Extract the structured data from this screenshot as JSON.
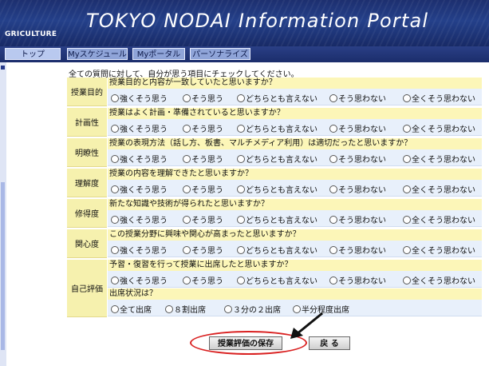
{
  "banner": {
    "left_text": "GRICULTURE",
    "title": "TOKYO NODAI Information Portal"
  },
  "nav": {
    "tabs": [
      "トップ",
      "Myスケジュール",
      "Myポータル",
      "パーソナライズ"
    ]
  },
  "form": {
    "intro": "全ての質問に対して、自分が思う項目にチェックしてください。",
    "scale_options": [
      "強くそう思う",
      "そう思う",
      "どちらとも言えない",
      "そう思わない",
      "全くそう思わない"
    ],
    "questions": [
      {
        "label": "授業目的",
        "text": "授業目的と内容が一致していたと思いますか？"
      },
      {
        "label": "計画性",
        "text": "授業はよく計画・準備されていると思いますか？"
      },
      {
        "label": "明瞭性",
        "text": "授業の表現方法（話し方、板書、マルチメディア利用）は適切だったと思いますか？"
      },
      {
        "label": "理解度",
        "text": "授業の内容を理解できたと思いますか？"
      },
      {
        "label": "修得度",
        "text": "新たな知識や技術が得られたと思いますか？"
      },
      {
        "label": "関心度",
        "text": "この授業分野に興味や関心が高まったと思いますか？"
      },
      {
        "label": "自己評価",
        "text": "予習・復習を行って授業に出席したと思いますか？"
      }
    ],
    "attendance": {
      "text": "出席状況は？",
      "options": [
        "全て出席",
        "８割出席",
        "３分の２出席",
        "半分程度出席"
      ]
    }
  },
  "buttons": {
    "save": "授業評価の保存",
    "back": "戻 る"
  },
  "colors": {
    "banner": "#1d2f6f",
    "label_bg": "#f6f1ae",
    "question_bg": "#fcf6b8",
    "options_bg": "#e8f0fb",
    "highlight": "#d92020"
  }
}
